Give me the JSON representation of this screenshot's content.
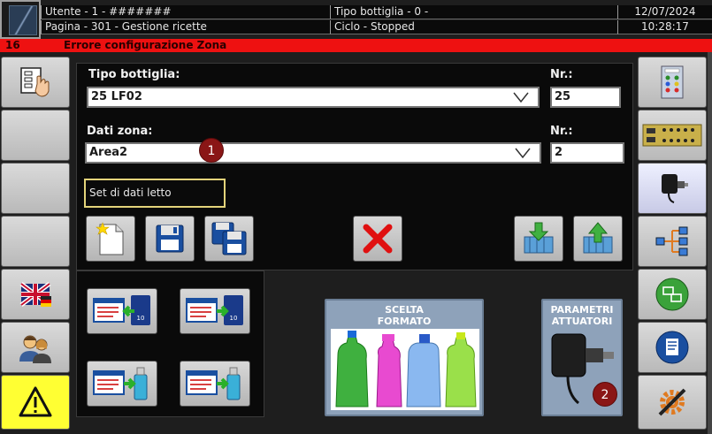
{
  "header": {
    "user": "Utente - 1 - #######",
    "page": "Pagina - 301 - Gestione ricette",
    "bottle_type": "Tipo bottiglia - 0 -",
    "cycle": "Ciclo - Stopped",
    "date": "12/07/2024",
    "time": "10:28:17"
  },
  "alarm": {
    "code": "16",
    "message": "Errore configurazione Zona"
  },
  "form": {
    "bottle_label": "Tipo bottiglia:",
    "bottle_value": "25 LF02",
    "bottle_nr_label": "Nr.:",
    "bottle_nr_value": "25",
    "zone_label": "Dati zona:",
    "zone_value": "Area2",
    "zone_nr_label": "Nr.:",
    "zone_nr_value": "2",
    "status_text": "Set di dati letto",
    "marker_1": "1"
  },
  "tiles": {
    "format_title": "SCELTA\nFORMATO",
    "format_line1": "SCELTA",
    "format_line2": "FORMATO",
    "actuators_line1": "PARAMETRI",
    "actuators_line2": "ATTUATORI",
    "marker_2": "2"
  },
  "icons": {
    "left": [
      "recipe-hand-icon",
      "",
      "",
      "",
      "uk-flag-icon",
      "users-icon",
      "warning-icon"
    ],
    "right": [
      "control-panel-icon",
      "circuit-board-icon",
      "actuator-icon",
      "network-tree-icon",
      "screen-switch-icon",
      "document-icon",
      "tools-gear-icon"
    ]
  },
  "colors": {
    "alarm": "#ee1111",
    "warning_button": "#ffff33",
    "badge": "#8a1616",
    "status_border": "#e3d37a"
  }
}
